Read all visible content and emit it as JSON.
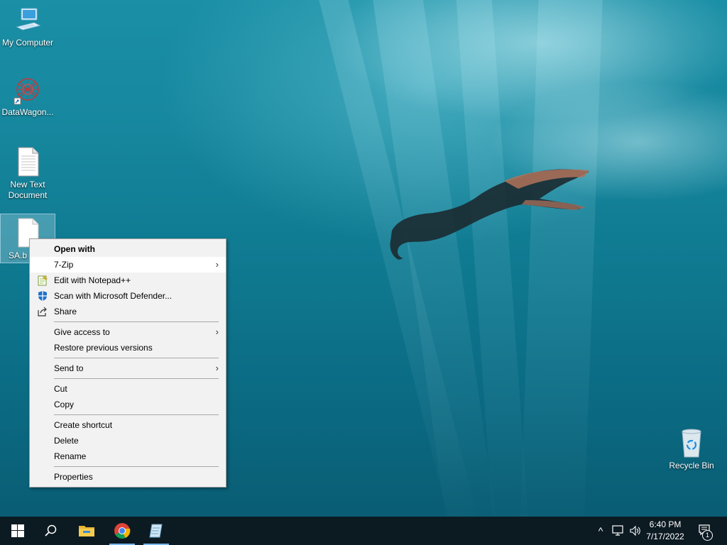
{
  "desktop_icons": [
    {
      "label": "My Computer",
      "icon": "computer-icon"
    },
    {
      "label": "DataWagon...",
      "icon": "datawagon-shortcut-icon"
    },
    {
      "label": "New Text\nDocument",
      "icon": "text-document-icon"
    },
    {
      "label": "SA.b",
      "icon": "text-document-icon"
    },
    {
      "label": "Recycle Bin",
      "icon": "recycle-bin-icon"
    }
  ],
  "context_menu": {
    "open_with": "Open with",
    "seven_zip": "7-Zip",
    "edit_notepad": "Edit with Notepad++",
    "scan_defender": "Scan with Microsoft Defender...",
    "share": "Share",
    "give_access": "Give access to",
    "restore_versions": "Restore previous versions",
    "send_to": "Send to",
    "cut": "Cut",
    "copy": "Copy",
    "create_shortcut": "Create shortcut",
    "delete": "Delete",
    "rename": "Rename",
    "properties": "Properties",
    "submenu_arrow": ">"
  },
  "taskbar": {
    "apps": [
      "start-icon",
      "search-icon",
      "file-explorer-icon",
      "chrome-icon",
      "notepad-icon"
    ],
    "tray": {
      "chevron": "^",
      "time": "6:40 PM",
      "date": "7/17/2022",
      "notification_count": "1"
    }
  },
  "colors": {
    "taskbar_bg": "#0c1a22",
    "menu_bg": "#f2f2f2",
    "menu_highlight": "#ffffff",
    "accent": "#76b9ed"
  }
}
